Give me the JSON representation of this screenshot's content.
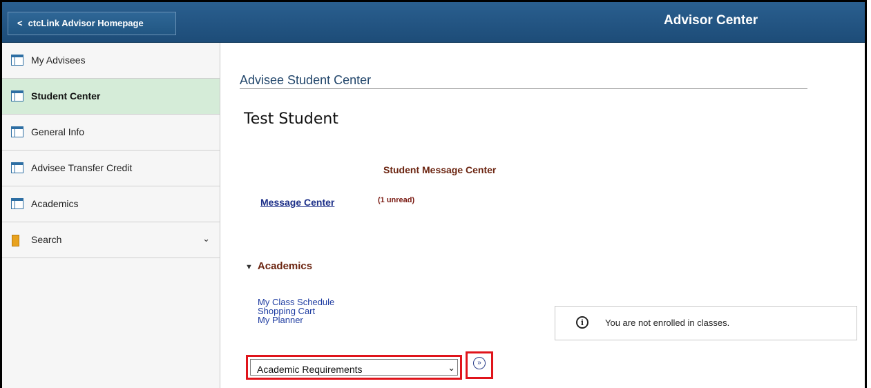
{
  "header": {
    "home_label": "ctcLink Advisor Homepage",
    "title": "Advisor Center"
  },
  "sidebar": {
    "items": [
      {
        "label": "My Advisees",
        "icon": "grid-icon"
      },
      {
        "label": "Student Center",
        "icon": "grid-icon",
        "active": true
      },
      {
        "label": "General Info",
        "icon": "grid-icon"
      },
      {
        "label": "Advisee Transfer Credit",
        "icon": "grid-icon"
      },
      {
        "label": "Academics",
        "icon": "grid-icon"
      },
      {
        "label": "Search",
        "icon": "folder-icon",
        "expandable": true
      }
    ]
  },
  "main": {
    "page_title": "Advisee Student Center",
    "student_name": "Test Student",
    "message_center": {
      "heading": "Student Message Center",
      "link": "Message Center",
      "unread": "(1 unread)"
    },
    "academics": {
      "heading": "Academics",
      "links": [
        "My Class Schedule",
        "Shopping Cart",
        "My Planner"
      ],
      "info_text": "You are not enrolled in classes.",
      "select_value": "Academic Requirements"
    }
  },
  "colors": {
    "header_bg": "#1d4c78",
    "active_nav": "#d5ecd8",
    "section_heading": "#6b2410",
    "highlight": "#e0141b"
  }
}
